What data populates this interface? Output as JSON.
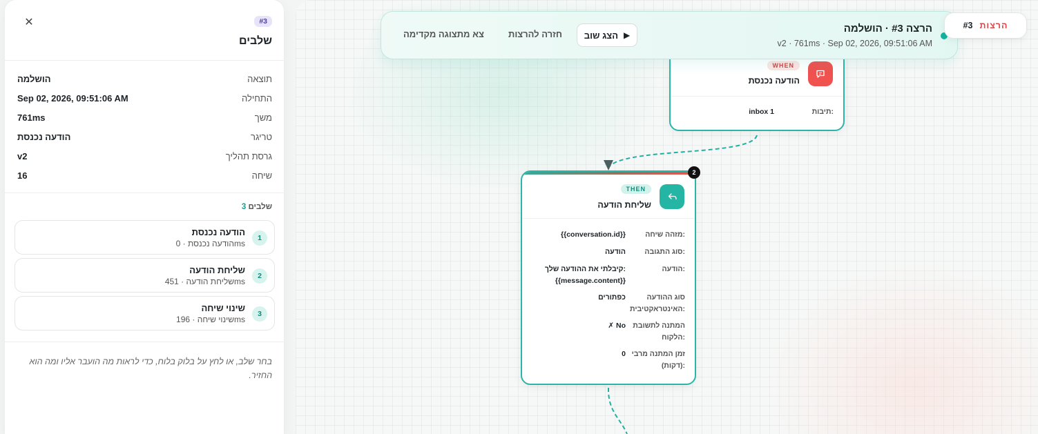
{
  "run_bar": {
    "title": "הרצה #3 · הושלמה",
    "subtitle": "v2 · 761ms · Sep 02, 2026, 09:51:06 AM",
    "replay_label": "הצג שוב",
    "back_label": "חזרה להרצות",
    "exit_label": "צא מתצוגה מקדימה"
  },
  "runs_chip": {
    "label": "הרצות",
    "value": "#3"
  },
  "panel": {
    "badge": "#3",
    "title": "שלבים",
    "close": "✕",
    "meta": [
      {
        "label": "תוצאה",
        "value": "הושלמה"
      },
      {
        "label": "התחילה",
        "value": "Sep 02, 2026, 09:51:06 AM"
      },
      {
        "label": "משך",
        "value": "761ms"
      },
      {
        "label": "טריגר",
        "value": "הודעה נכנסת"
      },
      {
        "label": "גרסת תהליך",
        "value": "v2"
      },
      {
        "label": "שיחה",
        "value": "16"
      }
    ],
    "steps_label": "שלבים",
    "steps_count": "3",
    "steps": [
      {
        "num": "1",
        "name": "הודעה נכנסת",
        "sub": "הודעה נכנסת · 0ms"
      },
      {
        "num": "2",
        "name": "שליחת הודעה",
        "sub": "שליחת הודעה · 451ms"
      },
      {
        "num": "3",
        "name": "שינוי שיחה",
        "sub": "שינוי שיחה · 196ms"
      }
    ],
    "hint": "בחר שלב, או לחץ על בלוק בלוח, כדי לראות מה הועבר אליו ומה הוא החזיר."
  },
  "nodes": {
    "trigger": {
      "badge": "WHEN",
      "title": "הודעה נכנסת",
      "props": [
        {
          "label": "תיבות:",
          "value": "inbox 1"
        }
      ]
    },
    "action": {
      "badge": "THEN",
      "title": "שליחת הודעה",
      "step_number": "2",
      "props": [
        {
          "label": "מזהה שיחה:",
          "value": "{{conversation.id}}"
        },
        {
          "label": "סוג התגובה:",
          "value": "הודעה"
        },
        {
          "label": "הודעה:",
          "value": "קיבלתי את ההודעה שלך: {{message.content}}"
        },
        {
          "label": "סוג ההודעה האינטראקטיבית:",
          "value": "כפתורים"
        },
        {
          "label": "המתנה לתשובת הלקוח:",
          "value": "✗ No"
        },
        {
          "label": "זמן המתנה מרבי (דקות):",
          "value": "0"
        }
      ]
    }
  },
  "colors": {
    "accent": "#2bb5a6",
    "trigger": "#f0524f",
    "action": "#25b5a5",
    "runs_label": "#e0454a"
  },
  "icons": {
    "trigger": "message-icon",
    "action": "reply-arrow-icon",
    "play": "play-icon",
    "close": "close-icon"
  }
}
